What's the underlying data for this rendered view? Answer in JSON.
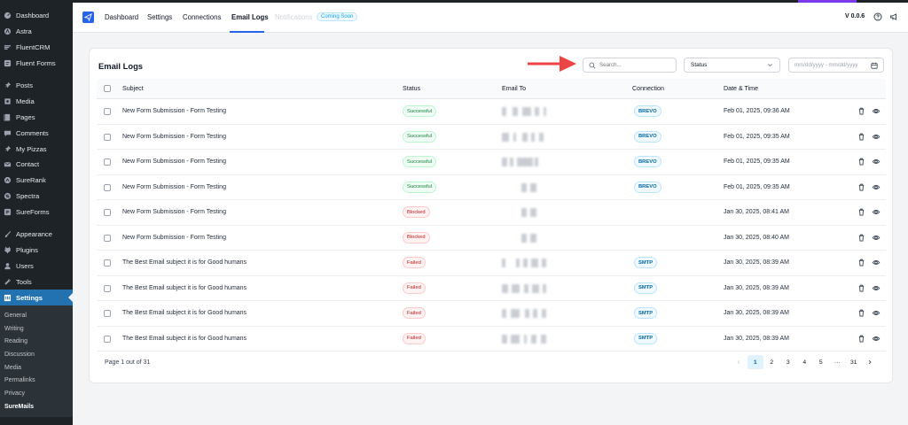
{
  "sidebar": {
    "items": [
      {
        "label": "Dashboard",
        "icon": "dashboard-icon"
      },
      {
        "label": "Astra",
        "icon": "astra-icon"
      },
      {
        "label": "FluentCRM",
        "icon": "fluentcrm-icon"
      },
      {
        "label": "Fluent Forms",
        "icon": "fluentforms-icon"
      },
      {
        "label": "Posts",
        "icon": "pin-icon"
      },
      {
        "label": "Media",
        "icon": "media-icon"
      },
      {
        "label": "Pages",
        "icon": "pages-icon"
      },
      {
        "label": "Comments",
        "icon": "comments-icon"
      },
      {
        "label": "My Pizzas",
        "icon": "pin-icon"
      },
      {
        "label": "Contact",
        "icon": "mail-icon"
      },
      {
        "label": "SureRank",
        "icon": "surerank-icon"
      },
      {
        "label": "Spectra",
        "icon": "spectra-icon"
      },
      {
        "label": "SureForms",
        "icon": "sureforms-icon"
      },
      {
        "label": "Appearance",
        "icon": "brush-icon"
      },
      {
        "label": "Plugins",
        "icon": "plugin-icon"
      },
      {
        "label": "Users",
        "icon": "users-icon"
      },
      {
        "label": "Tools",
        "icon": "tools-icon"
      },
      {
        "label": "Settings",
        "icon": "settings-icon"
      }
    ],
    "subitems": [
      "General",
      "Writing",
      "Reading",
      "Discussion",
      "Media",
      "Permalinks",
      "Privacy",
      "SureMails"
    ]
  },
  "topbar": {
    "nav": [
      "Dashboard",
      "Settings",
      "Connections",
      "Email Logs",
      "Notifications"
    ],
    "coming_soon": "Coming Soon",
    "version": "V 0.0.6"
  },
  "card": {
    "title": "Email Logs",
    "search_placeholder": "Search...",
    "status_label": "Status",
    "date_placeholder": "mm/dd/yyyy - mm/dd/yyyy"
  },
  "table": {
    "headers": [
      "Subject",
      "Status",
      "Email To",
      "Connection",
      "Date & Time"
    ],
    "rows": [
      {
        "subject": "New Form Submission - Form Testing",
        "status": "Successful",
        "status_type": "success",
        "connection": "BREVO",
        "datetime": "Feb 01, 2025, 09:36 AM"
      },
      {
        "subject": "New Form Submission - Form Testing",
        "status": "Successful",
        "status_type": "success",
        "connection": "BREVO",
        "datetime": "Feb 01, 2025, 09:35 AM"
      },
      {
        "subject": "New Form Submission - Form Testing",
        "status": "Successful",
        "status_type": "success",
        "connection": "BREVO",
        "datetime": "Feb 01, 2025, 09:35 AM"
      },
      {
        "subject": "New Form Submission - Form Testing",
        "status": "Successful",
        "status_type": "success",
        "connection": "BREVO",
        "datetime": "Feb 01, 2025, 09:35 AM"
      },
      {
        "subject": "New Form Submission - Form Testing",
        "status": "Blocked",
        "status_type": "blocked",
        "connection": "",
        "datetime": "Jan 30, 2025, 08:41 AM"
      },
      {
        "subject": "New Form Submission - Form Testing",
        "status": "Blocked",
        "status_type": "blocked",
        "connection": "",
        "datetime": "Jan 30, 2025, 08:40 AM"
      },
      {
        "subject": "The Best Email subject it is for Good humans",
        "status": "Failed",
        "status_type": "failed",
        "connection": "SMTP",
        "datetime": "Jan 30, 2025, 08:39 AM"
      },
      {
        "subject": "The Best Email subject it is for Good humans",
        "status": "Failed",
        "status_type": "failed",
        "connection": "SMTP",
        "datetime": "Jan 30, 2025, 08:39 AM"
      },
      {
        "subject": "The Best Email subject it is for Good humans",
        "status": "Failed",
        "status_type": "failed",
        "connection": "SMTP",
        "datetime": "Jan 30, 2025, 08:39 AM"
      },
      {
        "subject": "The Best Email subject it is for Good humans",
        "status": "Failed",
        "status_type": "failed",
        "connection": "SMTP",
        "datetime": "Jan 30, 2025, 08:39 AM"
      }
    ]
  },
  "pagination": {
    "summary": "Page 1 out of 31",
    "pages": [
      "1",
      "2",
      "3",
      "4",
      "5",
      "···",
      "31"
    ],
    "current": "1"
  },
  "colors": {
    "accent": "#2563eb",
    "sidebar_bg": "#1d2327",
    "sidebar_active": "#2271b1",
    "arrow": "#ef4444"
  }
}
